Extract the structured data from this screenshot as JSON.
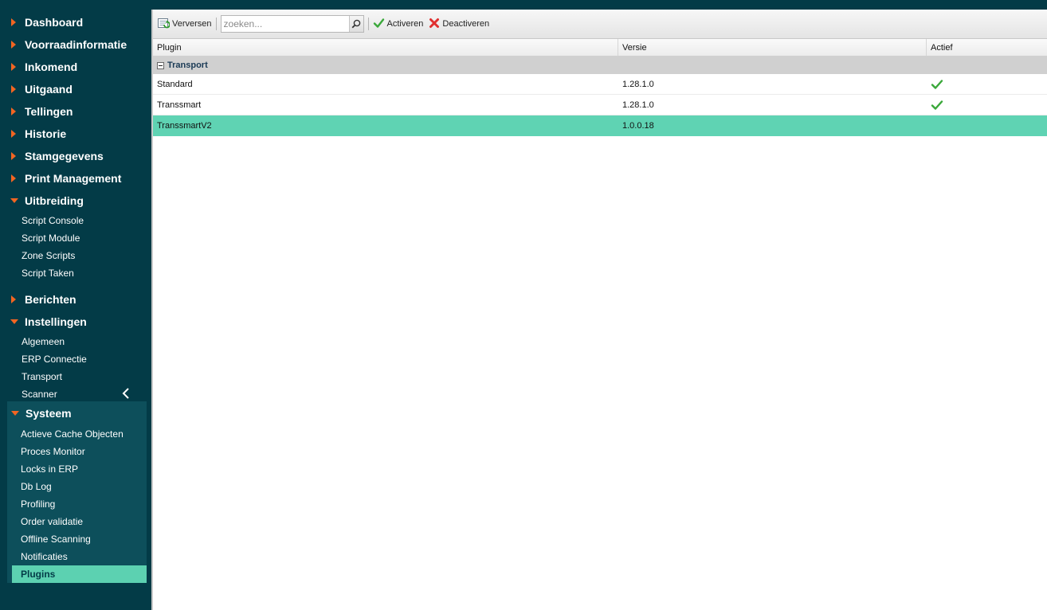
{
  "sidebar": {
    "sections": [
      {
        "label": "Dashboard"
      },
      {
        "label": "Voorraadinformatie"
      },
      {
        "label": "Inkomend"
      },
      {
        "label": "Uitgaand"
      },
      {
        "label": "Tellingen"
      },
      {
        "label": "Historie"
      },
      {
        "label": "Stamgegevens"
      },
      {
        "label": "Print Management"
      }
    ],
    "uitbreiding": {
      "label": "Uitbreiding",
      "items": [
        "Script Console",
        "Script Module",
        "Zone Scripts",
        "Script Taken"
      ]
    },
    "berichten": {
      "label": "Berichten"
    },
    "instellingen": {
      "label": "Instellingen",
      "items": [
        "Algemeen",
        "ERP Connectie",
        "Transport",
        "Scanner"
      ]
    },
    "systeem": {
      "label": "Systeem",
      "items": [
        "Actieve Cache Objecten",
        "Proces Monitor",
        "Locks in ERP",
        "Db Log",
        "Profiling",
        "Order validatie",
        "Offline Scanning",
        "Notificaties",
        "Plugins"
      ],
      "active": "Plugins"
    },
    "accent_color": "#f26522",
    "background_color": "#033b47"
  },
  "toolbar": {
    "refresh_label": "Verversen",
    "search_placeholder": "zoeken...",
    "activate_label": "Activeren",
    "deactivate_label": "Deactiveren"
  },
  "grid": {
    "columns": {
      "plugin": "Plugin",
      "versie": "Versie",
      "actief": "Actief"
    },
    "group": "Transport",
    "rows": [
      {
        "plugin": "Standard",
        "versie": "1.28.1.0",
        "actief": true
      },
      {
        "plugin": "Transsmart",
        "versie": "1.28.1.0",
        "actief": true
      },
      {
        "plugin": "TranssmartV2",
        "versie": "1.0.0.18",
        "actief": false,
        "selected": true
      }
    ],
    "selected_color": "#5fd3b3"
  }
}
